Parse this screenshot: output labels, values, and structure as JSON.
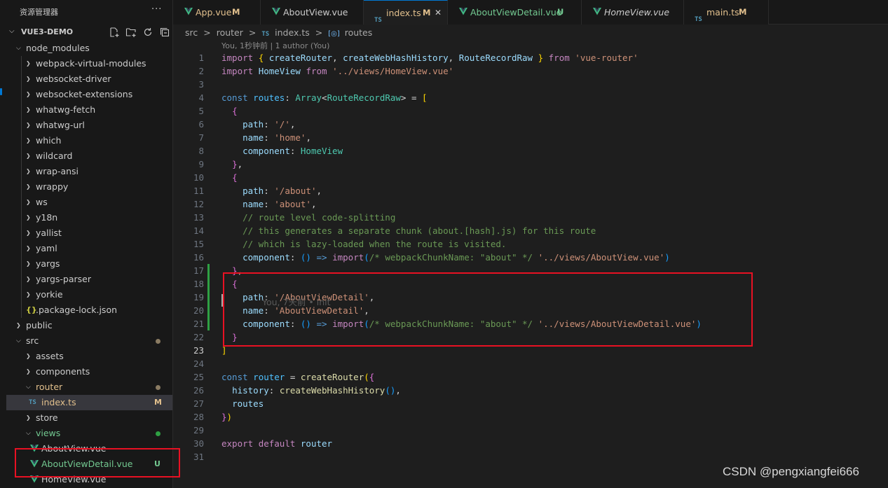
{
  "sidebar": {
    "header": "资源管理器",
    "more": "···",
    "project": "VUE3-DEMO",
    "tree": [
      {
        "label": "node_modules",
        "depth": 1,
        "chev": "down"
      },
      {
        "label": "webpack-virtual-modules",
        "depth": 2,
        "chev": "right"
      },
      {
        "label": "websocket-driver",
        "depth": 2,
        "chev": "right"
      },
      {
        "label": "websocket-extensions",
        "depth": 2,
        "chev": "right"
      },
      {
        "label": "whatwg-fetch",
        "depth": 2,
        "chev": "right"
      },
      {
        "label": "whatwg-url",
        "depth": 2,
        "chev": "right"
      },
      {
        "label": "which",
        "depth": 2,
        "chev": "right"
      },
      {
        "label": "wildcard",
        "depth": 2,
        "chev": "right"
      },
      {
        "label": "wrap-ansi",
        "depth": 2,
        "chev": "right"
      },
      {
        "label": "wrappy",
        "depth": 2,
        "chev": "right"
      },
      {
        "label": "ws",
        "depth": 2,
        "chev": "right"
      },
      {
        "label": "y18n",
        "depth": 2,
        "chev": "right"
      },
      {
        "label": "yallist",
        "depth": 2,
        "chev": "right"
      },
      {
        "label": "yaml",
        "depth": 2,
        "chev": "right"
      },
      {
        "label": "yargs",
        "depth": 2,
        "chev": "right"
      },
      {
        "label": "yargs-parser",
        "depth": 2,
        "chev": "right"
      },
      {
        "label": "yorkie",
        "depth": 2,
        "chev": "right"
      },
      {
        "label": ".package-lock.json",
        "depth": 2,
        "icon": "json"
      },
      {
        "label": "public",
        "depth": 1,
        "chev": "right"
      },
      {
        "label": "src",
        "depth": 1,
        "chev": "down",
        "dot": "#8a7b62"
      },
      {
        "label": "assets",
        "depth": 2,
        "chev": "right"
      },
      {
        "label": "components",
        "depth": 2,
        "chev": "right"
      },
      {
        "label": "router",
        "depth": 2,
        "chev": "down",
        "dot": "#8a7b62",
        "color": "#e2c08d"
      },
      {
        "label": "index.ts",
        "depth": 3,
        "icon": "ts",
        "badge": "M",
        "color": "#e2c08d",
        "selected": true
      },
      {
        "label": "store",
        "depth": 2,
        "chev": "right"
      },
      {
        "label": "views",
        "depth": 2,
        "chev": "down",
        "dot": "#2ea043",
        "color": "#73c991"
      },
      {
        "label": "AboutView.vue",
        "depth": 3,
        "icon": "vue"
      },
      {
        "label": "AboutViewDetail.vue",
        "depth": 3,
        "icon": "vue",
        "badge": "U",
        "color": "#73c991"
      },
      {
        "label": "HomeView.vue",
        "depth": 3,
        "icon": "vue"
      }
    ]
  },
  "tabs": [
    {
      "label": "App.vue",
      "status": "M",
      "icon": "vue",
      "color": "#e2c08d"
    },
    {
      "label": "AboutView.vue",
      "status": "",
      "icon": "vue",
      "color": "#cccccc"
    },
    {
      "label": "index.ts",
      "status": "M",
      "icon": "ts",
      "color": "#e2c08d",
      "active": true,
      "close": "✕"
    },
    {
      "label": "AboutViewDetail.vue",
      "status": "U",
      "icon": "vue",
      "color": "#73c991"
    },
    {
      "label": "HomeView.vue",
      "status": "",
      "icon": "vue",
      "color": "#cccccc",
      "italic": true
    },
    {
      "label": "main.ts",
      "status": "M",
      "icon": "ts",
      "color": "#e2c08d"
    }
  ],
  "breadcrumb": {
    "src": "src",
    "router": "router",
    "ts_tag": "TS",
    "file": "index.ts",
    "symbol_icon": "[◎]",
    "symbol": "routes",
    "sep": ">"
  },
  "blame": {
    "top": "You, 1秒钟前 | 1 author (You)",
    "inline": "You, 7天前 • init"
  },
  "editor": {
    "current_line": 23,
    "modified_lines": [
      17,
      18,
      19,
      20,
      21
    ],
    "lines": [
      [
        [
          "kw",
          "import"
        ],
        [
          "pl",
          " "
        ],
        [
          "b1",
          "{"
        ],
        [
          "pl",
          " "
        ],
        [
          "vr",
          "createRouter"
        ],
        [
          "pl",
          ", "
        ],
        [
          "vr",
          "createWebHashHistory"
        ],
        [
          "pl",
          ", "
        ],
        [
          "vr",
          "RouteRecordRaw"
        ],
        [
          "pl",
          " "
        ],
        [
          "b1",
          "}"
        ],
        [
          "pl",
          " "
        ],
        [
          "kw",
          "from"
        ],
        [
          "pl",
          " "
        ],
        [
          "st",
          "'vue-router'"
        ]
      ],
      [
        [
          "kw",
          "import"
        ],
        [
          "pl",
          " "
        ],
        [
          "vr",
          "HomeView"
        ],
        [
          "pl",
          " "
        ],
        [
          "kw",
          "from"
        ],
        [
          "pl",
          " "
        ],
        [
          "st",
          "'../views/HomeView.vue'"
        ]
      ],
      [],
      [
        [
          "kb",
          "const"
        ],
        [
          "pl",
          " "
        ],
        [
          "cn",
          "routes"
        ],
        [
          "pl",
          ": "
        ],
        [
          "ty",
          "Array"
        ],
        [
          "pl",
          "<"
        ],
        [
          "ty",
          "RouteRecordRaw"
        ],
        [
          "pl",
          "> = "
        ],
        [
          "b1",
          "["
        ]
      ],
      [
        [
          "pl",
          "  "
        ],
        [
          "b2",
          "{"
        ]
      ],
      [
        [
          "pl",
          "    "
        ],
        [
          "vr",
          "path"
        ],
        [
          "pl",
          ": "
        ],
        [
          "st",
          "'/'"
        ],
        [
          "pl",
          ","
        ]
      ],
      [
        [
          "pl",
          "    "
        ],
        [
          "vr",
          "name"
        ],
        [
          "pl",
          ": "
        ],
        [
          "st",
          "'home'"
        ],
        [
          "pl",
          ","
        ]
      ],
      [
        [
          "pl",
          "    "
        ],
        [
          "vr",
          "component"
        ],
        [
          "pl",
          ": "
        ],
        [
          "ty",
          "HomeView"
        ]
      ],
      [
        [
          "pl",
          "  "
        ],
        [
          "b2",
          "}"
        ],
        [
          "pl",
          ","
        ]
      ],
      [
        [
          "pl",
          "  "
        ],
        [
          "b2",
          "{"
        ]
      ],
      [
        [
          "pl",
          "    "
        ],
        [
          "vr",
          "path"
        ],
        [
          "pl",
          ": "
        ],
        [
          "st",
          "'/about'"
        ],
        [
          "pl",
          ","
        ]
      ],
      [
        [
          "pl",
          "    "
        ],
        [
          "vr",
          "name"
        ],
        [
          "pl",
          ": "
        ],
        [
          "st",
          "'about'"
        ],
        [
          "pl",
          ","
        ]
      ],
      [
        [
          "pl",
          "    "
        ],
        [
          "cm",
          "// route level code-splitting"
        ]
      ],
      [
        [
          "pl",
          "    "
        ],
        [
          "cm",
          "// this generates a separate chunk (about.[hash].js) for this route"
        ]
      ],
      [
        [
          "pl",
          "    "
        ],
        [
          "cm",
          "// which is lazy-loaded when the route is visited."
        ]
      ],
      [
        [
          "pl",
          "    "
        ],
        [
          "vr",
          "component"
        ],
        [
          "pl",
          ": "
        ],
        [
          "b3",
          "()"
        ],
        [
          "pl",
          " "
        ],
        [
          "kb",
          "=>"
        ],
        [
          "pl",
          " "
        ],
        [
          "kw",
          "import"
        ],
        [
          "b3",
          "("
        ],
        [
          "cm",
          "/* webpackChunkName: \"about\" */"
        ],
        [
          "pl",
          " "
        ],
        [
          "st",
          "'../views/AboutView.vue'"
        ],
        [
          "b3",
          ")"
        ]
      ],
      [
        [
          "pl",
          "  "
        ],
        [
          "b2",
          "}"
        ],
        [
          "pl",
          ","
        ]
      ],
      [
        [
          "pl",
          "  "
        ],
        [
          "b2",
          "{"
        ]
      ],
      [
        [
          "pl",
          "    "
        ],
        [
          "vr",
          "path"
        ],
        [
          "pl",
          ": "
        ],
        [
          "st",
          "'/AboutViewDetail'"
        ],
        [
          "pl",
          ","
        ]
      ],
      [
        [
          "pl",
          "    "
        ],
        [
          "vr",
          "name"
        ],
        [
          "pl",
          ": "
        ],
        [
          "st",
          "'AboutViewDetail'"
        ],
        [
          "pl",
          ","
        ]
      ],
      [
        [
          "pl",
          "    "
        ],
        [
          "vr",
          "component"
        ],
        [
          "pl",
          ": "
        ],
        [
          "b3",
          "()"
        ],
        [
          "pl",
          " "
        ],
        [
          "kb",
          "=>"
        ],
        [
          "pl",
          " "
        ],
        [
          "kw",
          "import"
        ],
        [
          "b3",
          "("
        ],
        [
          "cm",
          "/* webpackChunkName: \"about\" */"
        ],
        [
          "pl",
          " "
        ],
        [
          "st",
          "'../views/AboutViewDetail.vue'"
        ],
        [
          "b3",
          ")"
        ]
      ],
      [
        [
          "pl",
          "  "
        ],
        [
          "b2",
          "}"
        ]
      ],
      [
        [
          "b1",
          "]"
        ]
      ],
      [],
      [
        [
          "kb",
          "const"
        ],
        [
          "pl",
          " "
        ],
        [
          "cn",
          "router"
        ],
        [
          "pl",
          " = "
        ],
        [
          "fn",
          "createRouter"
        ],
        [
          "b1",
          "("
        ],
        [
          "b2",
          "{"
        ]
      ],
      [
        [
          "pl",
          "  "
        ],
        [
          "vr",
          "history"
        ],
        [
          "pl",
          ": "
        ],
        [
          "fn",
          "createWebHashHistory"
        ],
        [
          "b3",
          "()"
        ],
        [
          "pl",
          ","
        ]
      ],
      [
        [
          "pl",
          "  "
        ],
        [
          "vr",
          "routes"
        ]
      ],
      [
        [
          "b2",
          "}"
        ],
        [
          "b1",
          ")"
        ]
      ],
      [],
      [
        [
          "kw",
          "export"
        ],
        [
          "pl",
          " "
        ],
        [
          "kw",
          "default"
        ],
        [
          "pl",
          " "
        ],
        [
          "vr",
          "router"
        ]
      ],
      []
    ]
  },
  "watermark": "CSDN @pengxiangfei666"
}
